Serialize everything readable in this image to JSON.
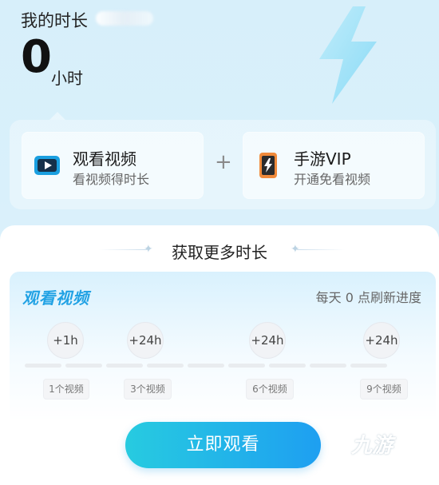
{
  "header": {
    "title": "我的时长",
    "hours_value": "0",
    "hours_unit": "小时"
  },
  "options": [
    {
      "name": "观看视频",
      "sub": "看视频得时长",
      "icon": "video-play-icon"
    },
    {
      "name": "手游VIP",
      "sub": "开通免看视频",
      "icon": "phone-bolt-icon"
    }
  ],
  "plus_sign": "+",
  "section": {
    "title": "获取更多时长"
  },
  "task": {
    "title": "观看视频",
    "note": "每天 0 点刷新进度",
    "rewards": [
      "+1h",
      "+24h",
      "+24h",
      "+24h"
    ],
    "milestones": [
      "1个视频",
      "3个视频",
      "6个视频",
      "9个视频"
    ],
    "progress": 0,
    "cta": "立即观看"
  },
  "watermark": {
    "text": "九游"
  },
  "colors": {
    "accent": "#22a2e4",
    "cta_start": "#27cbe0",
    "cta_end": "#1e9ff1"
  }
}
